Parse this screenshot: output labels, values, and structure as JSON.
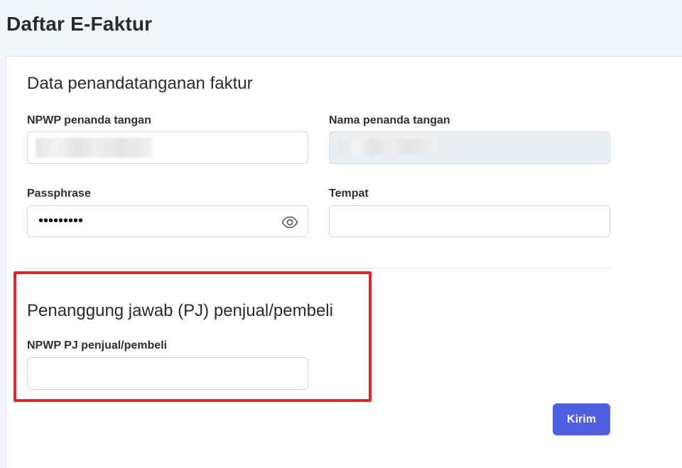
{
  "page": {
    "title": "Daftar E-Faktur"
  },
  "signer_section": {
    "title": "Data penandatanganan faktur",
    "npwp_label": "NPWP penanda tangan",
    "npwp_value": "",
    "name_label": "Nama penanda tangan",
    "name_value": "",
    "passphrase_label": "Passphrase",
    "passphrase_value": "•••••••••",
    "place_label": "Tempat",
    "place_value": ""
  },
  "pj_section": {
    "title": "Penanggung jawab (PJ) penjual/pembeli",
    "npwp_label": "NPWP PJ penjual/pembeli",
    "npwp_value": ""
  },
  "actions": {
    "submit_label": "Kirim"
  },
  "icons": {
    "passphrase_toggle": "eye-icon"
  },
  "colors": {
    "primary": "#4f5fe0",
    "highlight": "#e3242b",
    "disabled_bg": "#eceff2"
  }
}
